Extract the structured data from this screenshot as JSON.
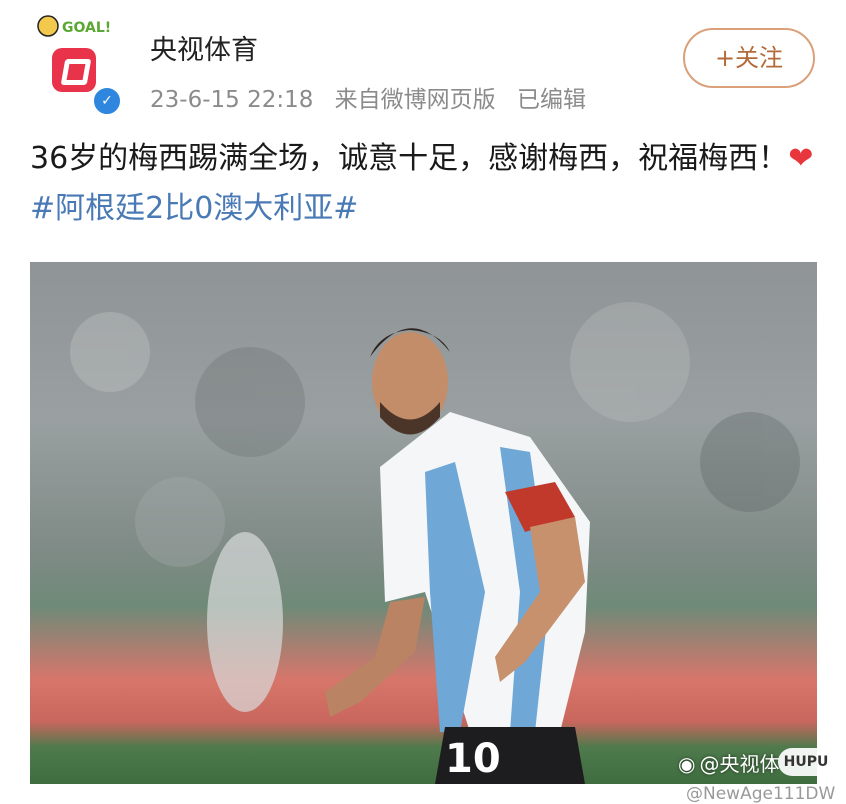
{
  "header": {
    "account_name": "央视体育",
    "goal_badge": "GOAL!",
    "timestamp": "23-6-15 22:18",
    "source": "来自微博网页版",
    "edited": "已编辑",
    "follow_label": "+关注"
  },
  "post": {
    "text": "36岁的梅西踢满全场，诚意十足，感谢梅西，祝福梅西！",
    "heart": "❤",
    "hashtag": "#阿根廷2比0澳大利亚#"
  },
  "photo": {
    "jersey_number": "10",
    "watermark_text": "@央视体",
    "hupu_badge": "HUPU",
    "handle": "@NewAge111DW"
  },
  "colors": {
    "accent_follow": "#b36a3a",
    "hashtag": "#4a7ab5",
    "verified": "#2e86de"
  }
}
